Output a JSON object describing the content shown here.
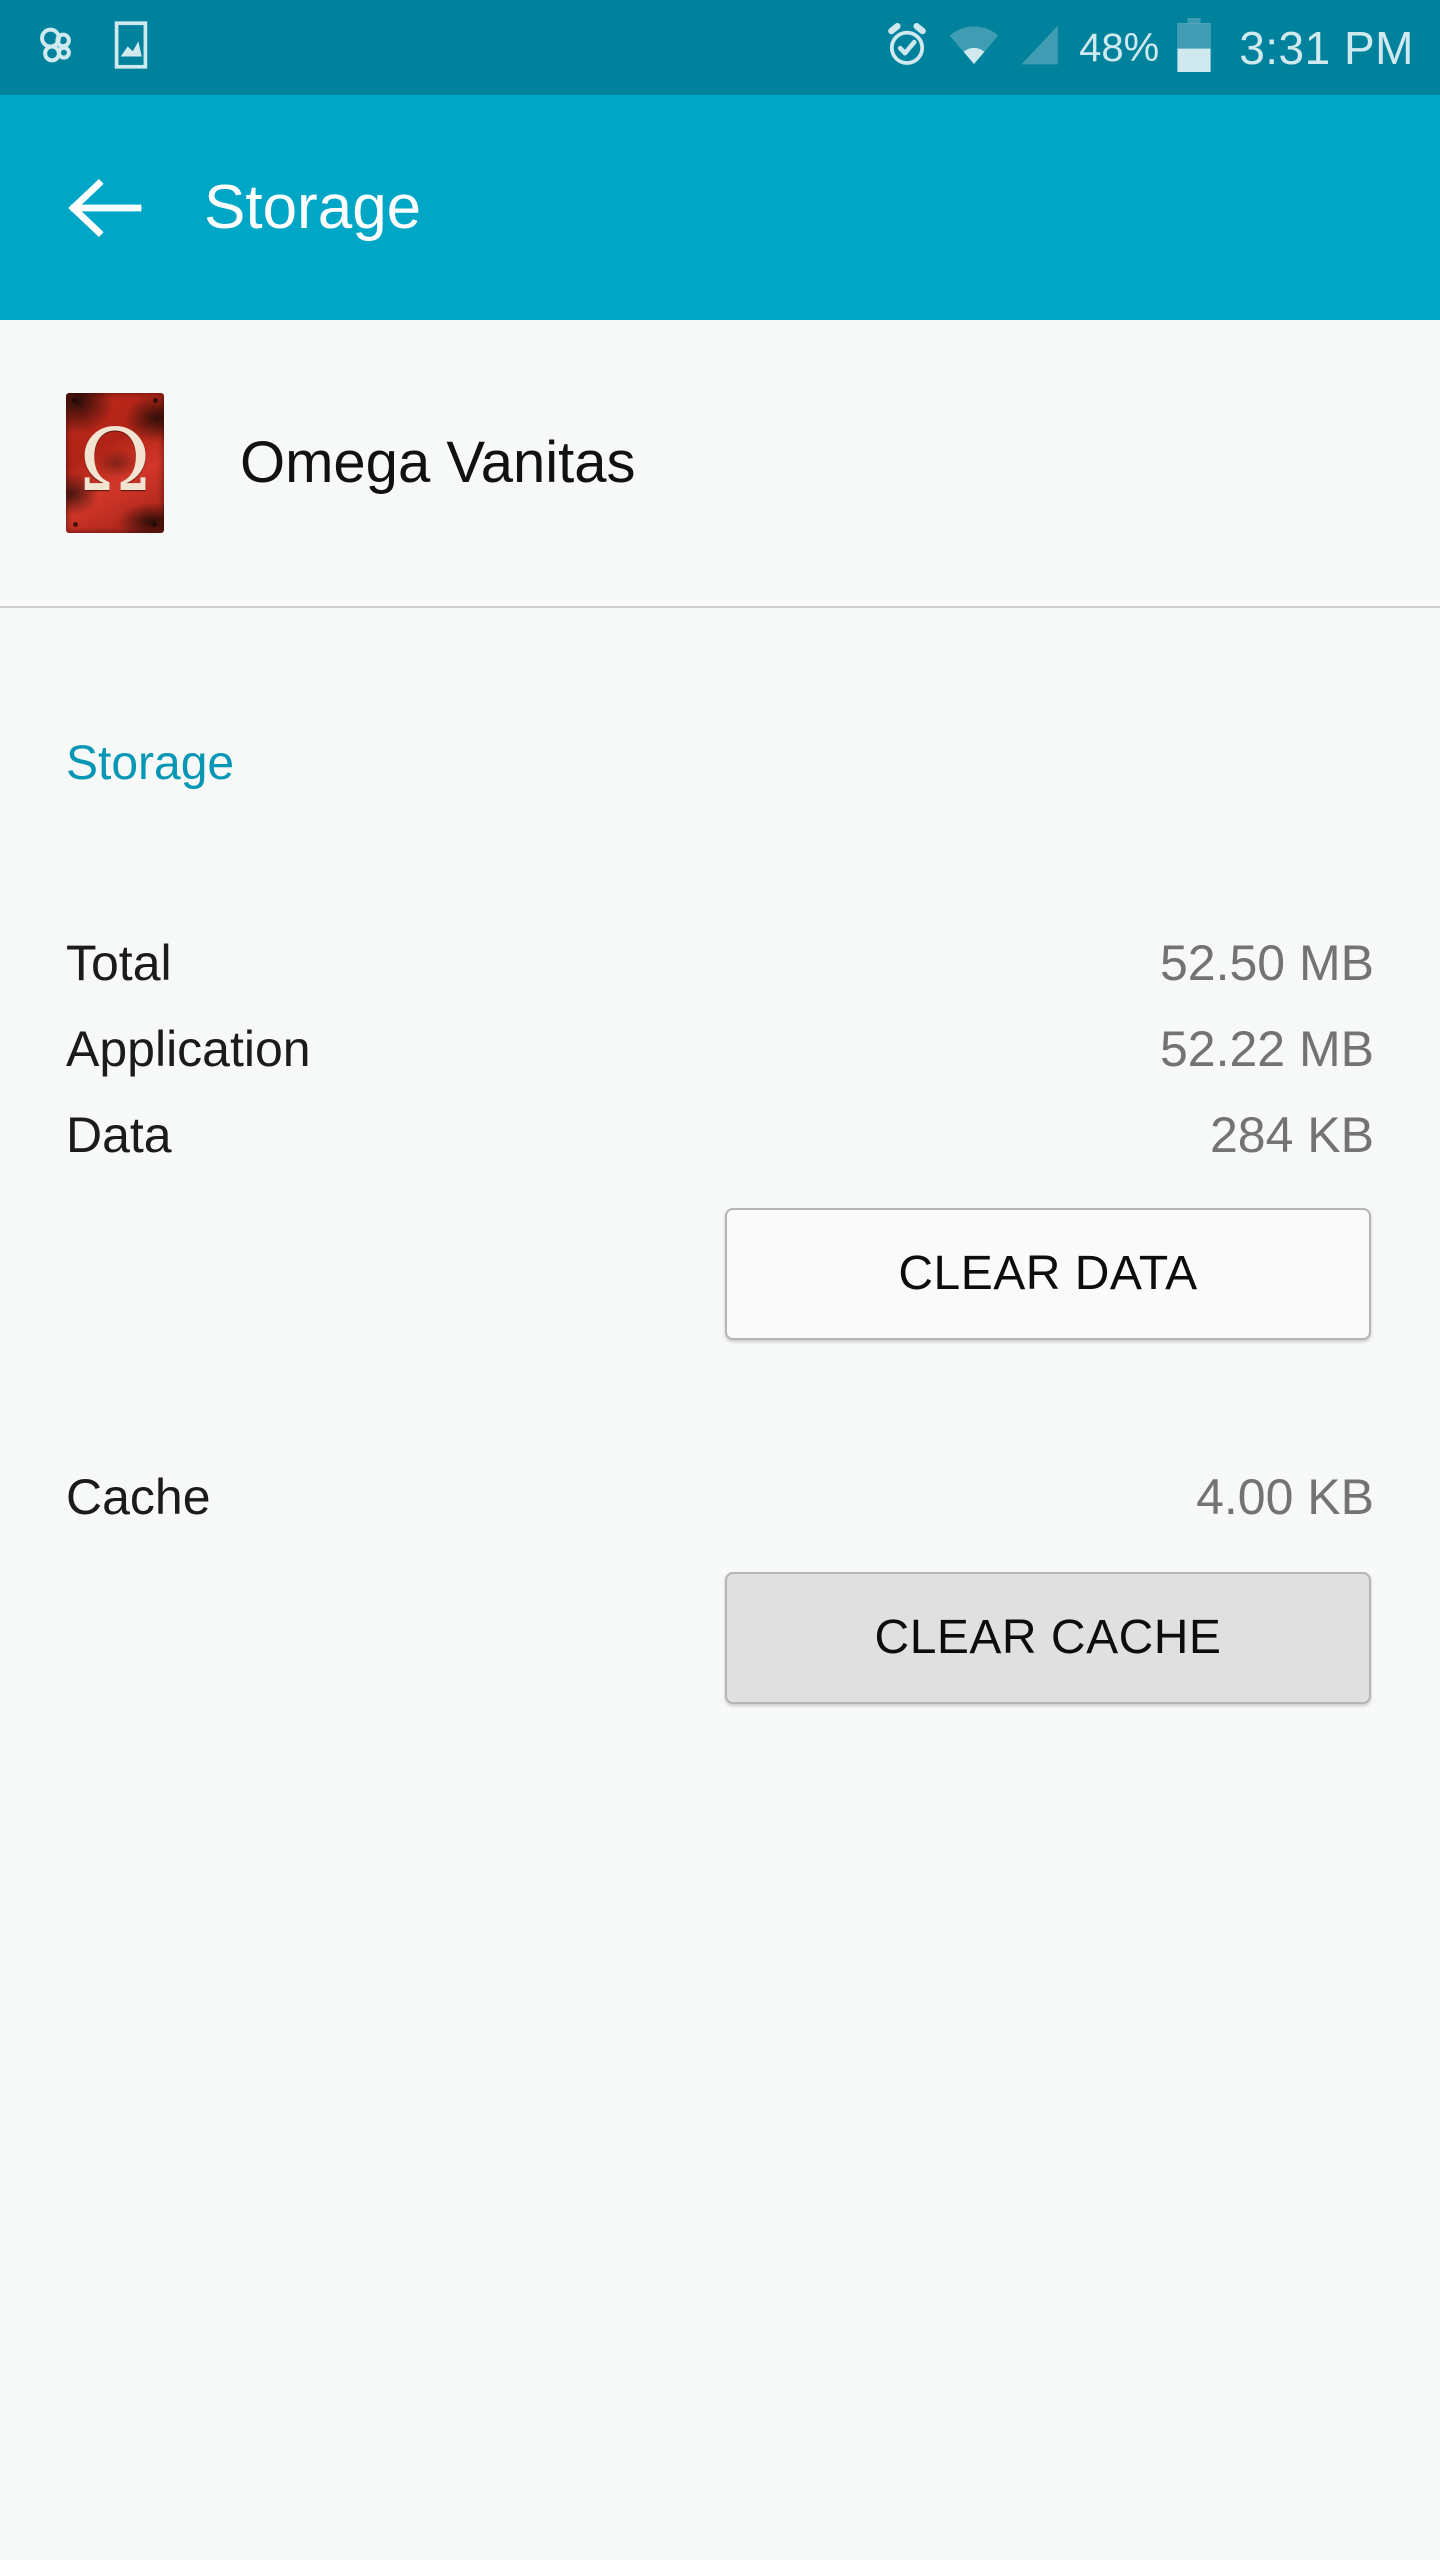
{
  "status_bar": {
    "background_color": "#00829c",
    "icon_color": "#cfe9ef",
    "left_icons": [
      {
        "name": "group-notification-icon",
        "label": "group"
      },
      {
        "name": "screenshot-image-icon",
        "label": "screenshot"
      }
    ],
    "right_icons": [
      {
        "name": "alarm-clock-icon",
        "label": "alarm set"
      },
      {
        "name": "wifi-icon",
        "label": "wifi"
      },
      {
        "name": "cellular-signal-icon",
        "label": "signal"
      }
    ],
    "battery_percent": "48%",
    "battery_level": 48,
    "time": "3:31 PM"
  },
  "action_bar": {
    "background_color": "#00a6c6",
    "back_label": "Back",
    "title": "Storage"
  },
  "app_header": {
    "app_name": "Omega Vanitas",
    "icon_glyph": "Ω",
    "icon_description": "weathered red metal plate with cream omega symbol"
  },
  "content": {
    "section_title": "Storage",
    "section_title_color": "#0797b4",
    "rows": [
      {
        "label": "Total",
        "value": "52.50 MB"
      },
      {
        "label": "Application",
        "value": "52.22 MB"
      },
      {
        "label": "Data",
        "value": "284 KB"
      },
      {
        "label": "Cache",
        "value": "4.00 KB"
      }
    ],
    "buttons": {
      "clear_data": {
        "label": "CLEAR DATA",
        "background_color": "#fafafa"
      },
      "clear_cache": {
        "label": "CLEAR CACHE",
        "background_color": "#e0e0e0"
      }
    }
  }
}
